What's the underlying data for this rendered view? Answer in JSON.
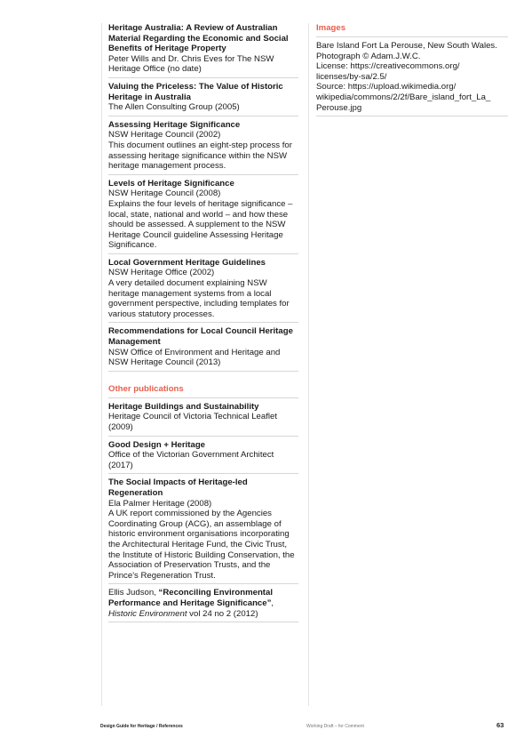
{
  "left_column": {
    "entries": [
      {
        "title": "Heritage Australia: A Review of Australian Material Regarding the Economic and Social Benefits of Heritage Property",
        "source": "Peter Wills and Dr. Chris Eves for The NSW Heritage Office (no date)",
        "description": ""
      },
      {
        "title": "Valuing the Priceless: The Value of Historic Heritage in Australia",
        "source": "The Allen Consulting Group (2005)",
        "description": ""
      },
      {
        "title": "Assessing Heritage Significance",
        "source": "NSW Heritage Council (2002)",
        "description": "This document outlines an eight-step process for assessing heritage significance within the NSW heritage management process."
      },
      {
        "title": "Levels of Heritage Significance",
        "source": "NSW Heritage Council (2008)",
        "description": "Explains the four levels of heritage significance – local, state, national and world – and how these should be assessed. A supplement to the NSW Heritage Council guideline Assessing Heritage Significance."
      },
      {
        "title": "Local Government Heritage Guidelines",
        "source": "NSW Heritage Office (2002)",
        "description": "A very detailed document explaining NSW heritage management systems from a local government perspective, including templates for various statutory processes."
      },
      {
        "title": "Recommendations for Local Council Heritage Management",
        "source": "NSW Office of Environment and Heritage and NSW Heritage Council (2013)",
        "description": ""
      }
    ],
    "other_heading": "Other publications",
    "other_entries": [
      {
        "title": "Heritage Buildings and Sustainability",
        "source": "Heritage Council of Victoria Technical Leaflet (2009)",
        "description": ""
      },
      {
        "title": "Good Design + Heritage",
        "source": "Office of the Victorian Government Architect (2017)",
        "description": ""
      },
      {
        "title": "The Social Impacts of Heritage-led Regeneration",
        "source": "Ela Palmer Heritage (2008)",
        "description": "A UK report commissioned by the Agencies Coordinating Group (ACG), an assemblage of historic environment organisations incorporating the Architectural Heritage Fund, the Civic Trust, the Institute of Historic Building Conservation, the Association of Preservation Trusts, and the Prince's Regeneration Trust."
      }
    ],
    "judson": {
      "author": "Ellis Judson, ",
      "title": "“Reconciling Environmental Performance and Heritage Significance”",
      "after_title": ",",
      "journal": "Historic Environment",
      "details": " vol 24 no 2 (2012)"
    }
  },
  "right_column": {
    "heading": "Images",
    "lines": [
      "Bare Island Fort La Perouse, New South Wales.",
      "Photograph © Adam.J.W.C.",
      "License: https://creativecommons.org/",
      "licenses/by-sa/2.5/",
      "Source: https://upload.wikimedia.org/",
      "wikipedia/commons/2/2f/Bare_island_fort_La_",
      "Perouse.jpg"
    ]
  },
  "footer": {
    "left": "Design Guide for Heritage / References",
    "middle": "Working Draft – for Comment",
    "page_number": "63"
  },
  "colors": {
    "accent": "#e8604c",
    "rule": "#d6d6d6",
    "text": "#1a1a1a"
  }
}
